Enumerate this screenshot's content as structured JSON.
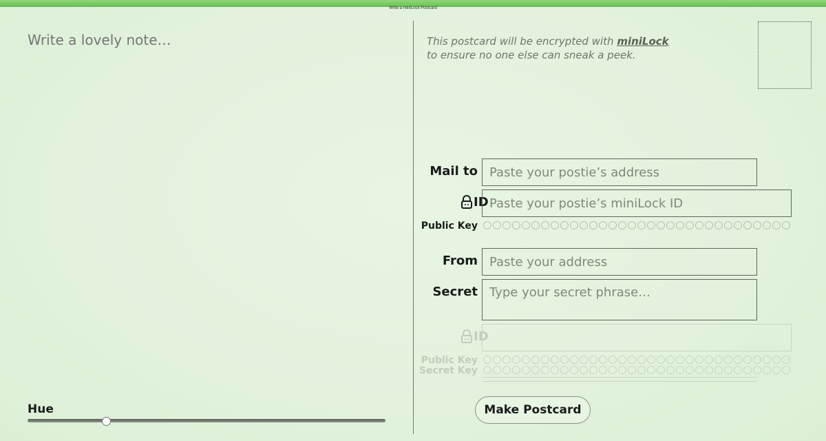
{
  "window": {
    "title": "Write a miniLock Postcard"
  },
  "note": {
    "placeholder": "Write a lovely note…"
  },
  "intro": {
    "line1_prefix": "This postcard will be encrypted with ",
    "link": "miniLock",
    "line2": "to ensure no one else can sneak a peek."
  },
  "mail_to": {
    "label": "Mail to",
    "placeholder": "Paste your postie’s address"
  },
  "recipient_id": {
    "label": "ID",
    "placeholder": "Paste your postie’s miniLock ID",
    "icon": "lock-icon"
  },
  "recipient_public_key": {
    "label": "Public Key"
  },
  "from": {
    "label": "From",
    "placeholder": "Paste your address"
  },
  "secret": {
    "label": "Secret",
    "placeholder": "Type your secret phrase…"
  },
  "sender_id": {
    "label": "ID",
    "icon": "lock-icon"
  },
  "sender_public_key": {
    "label": "Public Key"
  },
  "sender_secret_key": {
    "label": "Secret Key"
  },
  "make_button": {
    "label": "Make Postcard"
  },
  "hue": {
    "label": "Hue",
    "value": 0.22
  },
  "colors": {
    "background": "#e4f4e0",
    "titlebar": "#7ccc66",
    "border": "#5d6658"
  }
}
